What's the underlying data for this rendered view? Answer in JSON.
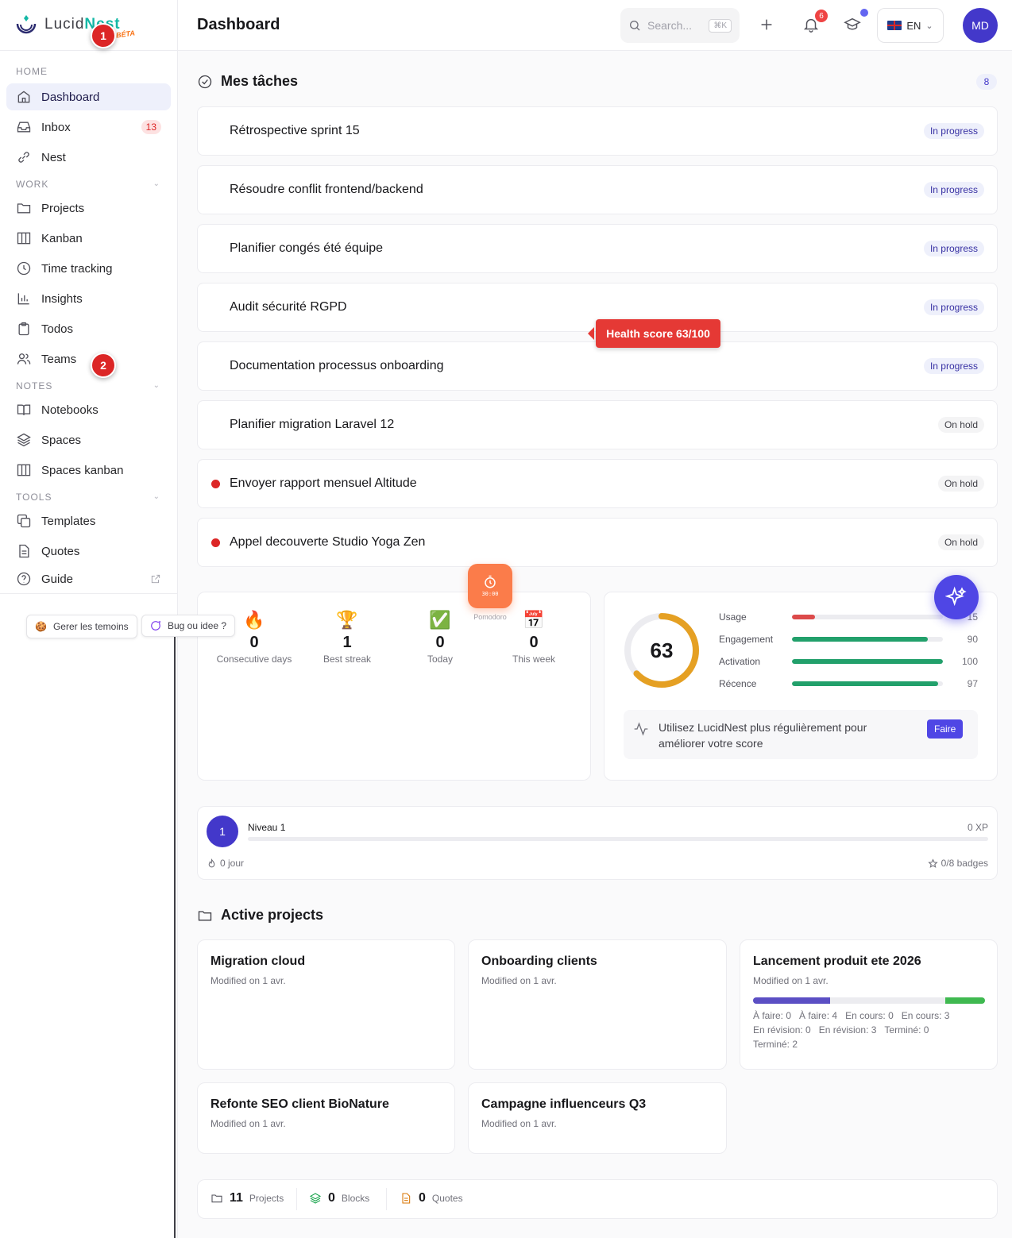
{
  "brand": {
    "part1": "Lucid",
    "part2": "Nest",
    "beta": "BÉTA"
  },
  "markers": [
    "1",
    "2"
  ],
  "sidebar": {
    "sections": {
      "home": "HOME",
      "work": "WORK",
      "notes": "NOTES",
      "tools": "TOOLS"
    },
    "items": [
      {
        "label": "Dashboard"
      },
      {
        "label": "Inbox",
        "count": "13"
      },
      {
        "label": "Nest"
      },
      {
        "label": "Projects"
      },
      {
        "label": "Kanban"
      },
      {
        "label": "Time tracking"
      },
      {
        "label": "Insights"
      },
      {
        "label": "Todos"
      },
      {
        "label": "Teams"
      },
      {
        "label": "Notebooks"
      },
      {
        "label": "Spaces"
      },
      {
        "label": "Spaces kanban"
      },
      {
        "label": "Templates"
      },
      {
        "label": "Quotes"
      },
      {
        "label": "Guide"
      }
    ],
    "cookies_label": "Gerer les temoins",
    "bug_label": "Bug ou idee ?"
  },
  "header": {
    "title": "Dashboard",
    "search_placeholder": "Search...",
    "search_kbd": "⌘K",
    "notif_count": "6",
    "lang": "EN",
    "avatar": "MD"
  },
  "tasks": {
    "title": "Mes tâches",
    "count": "8",
    "items": [
      {
        "title": "Rétrospective sprint 15",
        "status": "In progress"
      },
      {
        "title": "Résoudre conflit frontend/backend",
        "status": "In progress"
      },
      {
        "title": "Planifier congés été équipe",
        "status": "In progress"
      },
      {
        "title": "Audit sécurité RGPD",
        "status": "In progress"
      },
      {
        "title": "Documentation processus onboarding",
        "status": "In progress"
      },
      {
        "title": "Planifier migration Laravel 12",
        "status": "On hold"
      },
      {
        "title": "Envoyer rapport mensuel Altitude",
        "status": "On hold"
      },
      {
        "title": "Appel decouverte Studio Yoga Zen",
        "status": "On hold"
      }
    ]
  },
  "tooltip": "Health score 63/100",
  "streak": {
    "stats": [
      {
        "emoji": "🔥",
        "value": "0",
        "label": "Consecutive days"
      },
      {
        "emoji": "🏆",
        "value": "1",
        "label": "Best streak"
      },
      {
        "emoji": "✅",
        "value": "0",
        "label": "Today"
      },
      {
        "emoji": "📅",
        "value": "0",
        "label": "This week"
      }
    ],
    "pomodoro_time": "30:00",
    "pomodoro_label": "Pomodoro"
  },
  "health": {
    "score": "63",
    "score_value": 63,
    "metrics": [
      {
        "name": "Usage",
        "value": "15",
        "level": 15,
        "color": "#dc4a4a"
      },
      {
        "name": "Engagement",
        "value": "90",
        "level": 90,
        "color": "#22a06b"
      },
      {
        "name": "Activation",
        "value": "100",
        "level": 100,
        "color": "#22a06b"
      },
      {
        "name": "Récence",
        "value": "97",
        "level": 97,
        "color": "#22a06b"
      }
    ],
    "tip": "Utilisez LucidNest plus régulièrement pour améliorer votre score",
    "tip_button": "Faire",
    "ring_color": "#e5a023"
  },
  "level": {
    "number": "1",
    "label": "Niveau 1",
    "xp": "0 XP",
    "days": "0 jour",
    "badges": "0/8 badges"
  },
  "projects": {
    "title": "Active projects",
    "items": [
      {
        "name": "Migration cloud",
        "modified": "Modified on 1 avr."
      },
      {
        "name": "Onboarding clients",
        "modified": "Modified on 1 avr."
      },
      {
        "name": "Lancement produit ete 2026",
        "modified": "Modified on 1 avr.",
        "legend": [
          "À faire: 0",
          "À faire: 4",
          "En cours: 0",
          "En cours: 3",
          "En révision: 0",
          "En révision: 3",
          "Terminé: 0",
          "Terminé: 2"
        ]
      },
      {
        "name": "Refonte SEO client BioNature",
        "modified": "Modified on 1 avr."
      },
      {
        "name": "Campagne influenceurs Q3",
        "modified": "Modified on 1 avr."
      }
    ]
  },
  "footer": [
    {
      "value": "11",
      "label": "Projects"
    },
    {
      "value": "0",
      "label": "Blocks"
    },
    {
      "value": "0",
      "label": "Quotes"
    }
  ]
}
